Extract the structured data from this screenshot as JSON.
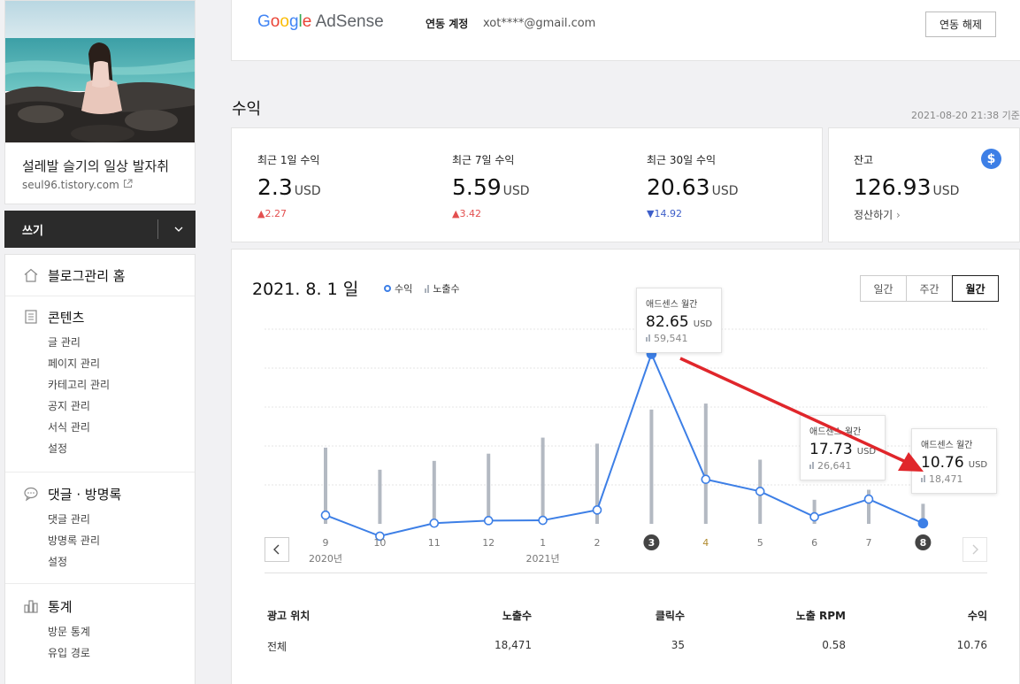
{
  "sidebar": {
    "blog_title": "설레발 슬기의 일상 발자취",
    "blog_url": "seul96.tistory.com",
    "write_label": "쓰기",
    "sections": [
      {
        "title": "블로그관리 홈",
        "items": []
      },
      {
        "title": "콘텐츠",
        "items": [
          "글 관리",
          "페이지 관리",
          "카테고리 관리",
          "공지 관리",
          "서식 관리",
          "설정"
        ]
      },
      {
        "title": "댓글 · 방명록",
        "items": [
          "댓글 관리",
          "방명록 관리",
          "설정"
        ]
      },
      {
        "title": "통계",
        "items": [
          "방문 통계",
          "유입 경로"
        ]
      }
    ]
  },
  "header": {
    "logo_google": "Google",
    "logo_adsense": "AdSense",
    "linked_label": "연동 계정",
    "linked_email": "xot****@gmail.com",
    "unlink_button": "연동 해제"
  },
  "earnings": {
    "title": "수익",
    "updated_at": "2021-08-20 21:38 기준",
    "cards": [
      {
        "label": "최근 1일 수익",
        "value": "2.3",
        "unit": "USD",
        "change": "2.27",
        "direction": "up"
      },
      {
        "label": "최근 7일 수익",
        "value": "5.59",
        "unit": "USD",
        "change": "3.42",
        "direction": "up"
      },
      {
        "label": "최근 30일 수익",
        "value": "20.63",
        "unit": "USD",
        "change": "14.92",
        "direction": "down"
      }
    ],
    "balance": {
      "label": "잔고",
      "value": "126.93",
      "unit": "USD",
      "settle_link": "정산하기"
    }
  },
  "chart": {
    "date_label": "2021. 8. 1 일",
    "legend_revenue": "수익",
    "legend_impressions": "노출수",
    "period_tabs": [
      "일간",
      "주간",
      "월간"
    ],
    "active_tab": "월간",
    "year_labels": [
      {
        "label": "2020년",
        "index": 0
      },
      {
        "label": "2021년",
        "index": 4
      }
    ],
    "tooltips": [
      {
        "title": "애드센스 월간",
        "value": "82.65",
        "unit": "USD",
        "impressions": "59,541"
      },
      {
        "title": "애드센스 월간",
        "value": "17.73",
        "unit": "USD",
        "impressions": "26,641"
      },
      {
        "title": "애드센스 월간",
        "value": "10.76",
        "unit": "USD",
        "impressions": "18,471"
      }
    ]
  },
  "chart_data": {
    "type": "line",
    "categories": [
      "9",
      "10",
      "11",
      "12",
      "1",
      "2",
      "3",
      "4",
      "5",
      "6",
      "7",
      "8"
    ],
    "highlighted_categories": [
      "3",
      "8"
    ],
    "series": [
      {
        "name": "수익",
        "type": "line",
        "values": [
          14.2,
          5.3,
          10.8,
          11.9,
          12.0,
          16.4,
          82.65,
          29.4,
          24.3,
          13.5,
          21.0,
          10.76
        ]
      },
      {
        "name": "노출수",
        "type": "bar",
        "values": [
          19000,
          13500,
          15700,
          17500,
          21500,
          20000,
          28500,
          30000,
          16000,
          6000,
          8500,
          5000
        ]
      }
    ],
    "ylim_revenue": [
      0,
      100
    ],
    "grid": true,
    "legend": "top-left"
  },
  "table": {
    "headers": [
      "광고 위치",
      "노출수",
      "클릭수",
      "노출 RPM",
      "수익"
    ],
    "rows": [
      [
        "전체",
        "18,471",
        "35",
        "0.58",
        "10.76"
      ]
    ]
  },
  "colors": {
    "accent": "#3d7fe6",
    "up": "#e34f4f",
    "down": "#3d5ec9",
    "bar": "#b3b9c2",
    "annotation_arrow": "#e0262b"
  }
}
